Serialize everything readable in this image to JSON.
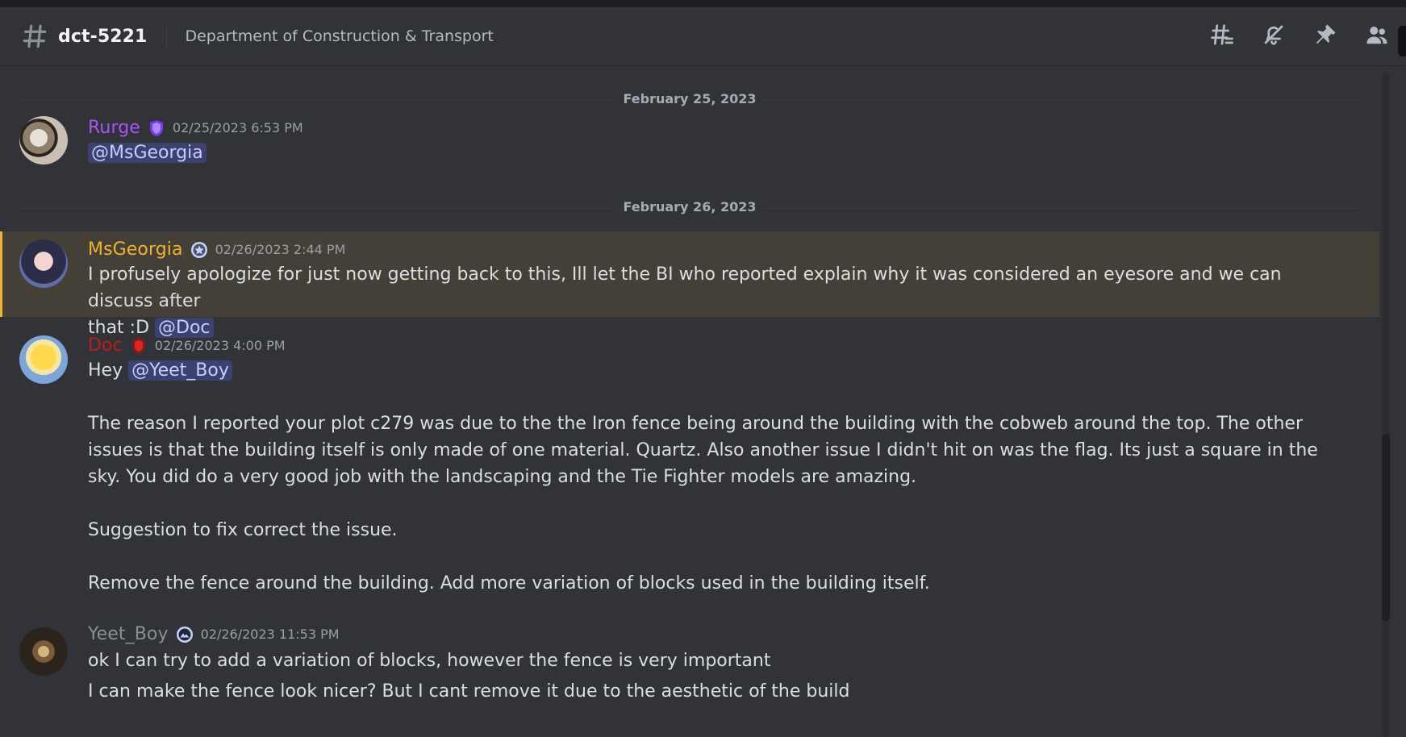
{
  "header": {
    "channel_name": "dct-5221",
    "topic": "Department of Construction & Transport"
  },
  "dates": [
    "February 25, 2023",
    "February 26, 2023"
  ],
  "messages": [
    {
      "author": "Rurge",
      "author_color": "#a855f7",
      "badge_icon": "shield-icon",
      "timestamp": "02/25/2023 6:53 PM",
      "lines": [
        {
          "mention": "@MsGeorgia"
        }
      ]
    },
    {
      "author": "MsGeorgia",
      "author_color": "#f0b232",
      "badge_icon": "star-badge-icon",
      "timestamp": "02/26/2023 2:44 PM",
      "line1": "I profusely apologize for just now getting back to this, Ill let the BI who reported explain why it was considered an eyesore and we can discuss after",
      "line2_prefix": "that :D ",
      "line2_mention": "@Doc"
    },
    {
      "author": "Doc",
      "author_color": "#b91c1c",
      "badge_icon": "shield-red-icon",
      "timestamp": "02/26/2023 4:00 PM",
      "line1_prefix": "Hey ",
      "line1_mention": "@Yeet_Boy",
      "p1": "The reason I reported your plot c279 was due to the the Iron fence being around the building with the cobweb around the top. The other issues is that the building itself is only made of one material. Quartz. Also another issue I didn't hit on was the flag. Its just a square in the sky. You did do a very good job with the landscaping  and the Tie Fighter models are amazing.",
      "p2": "Suggestion to fix correct the issue.",
      "p3": "Remove the fence around the building. Add more variation of blocks used in the building itself."
    },
    {
      "author": "Yeet_Boy",
      "author_color": "#8b8f96",
      "badge_icon": "mountain-badge-icon",
      "timestamp": "02/26/2023 11:53 PM",
      "l1": "ok I can try to add a variation of blocks, however the fence is very important",
      "l2": "I can make the fence look nicer? But I cant remove it due to the aesthetic of the build"
    }
  ],
  "colors": {
    "background": "#313338",
    "highlight_bg": "#444037",
    "highlight_bar": "#f0b232",
    "mention_bg": "#3f4378",
    "mention_text": "#c9cdfb"
  }
}
